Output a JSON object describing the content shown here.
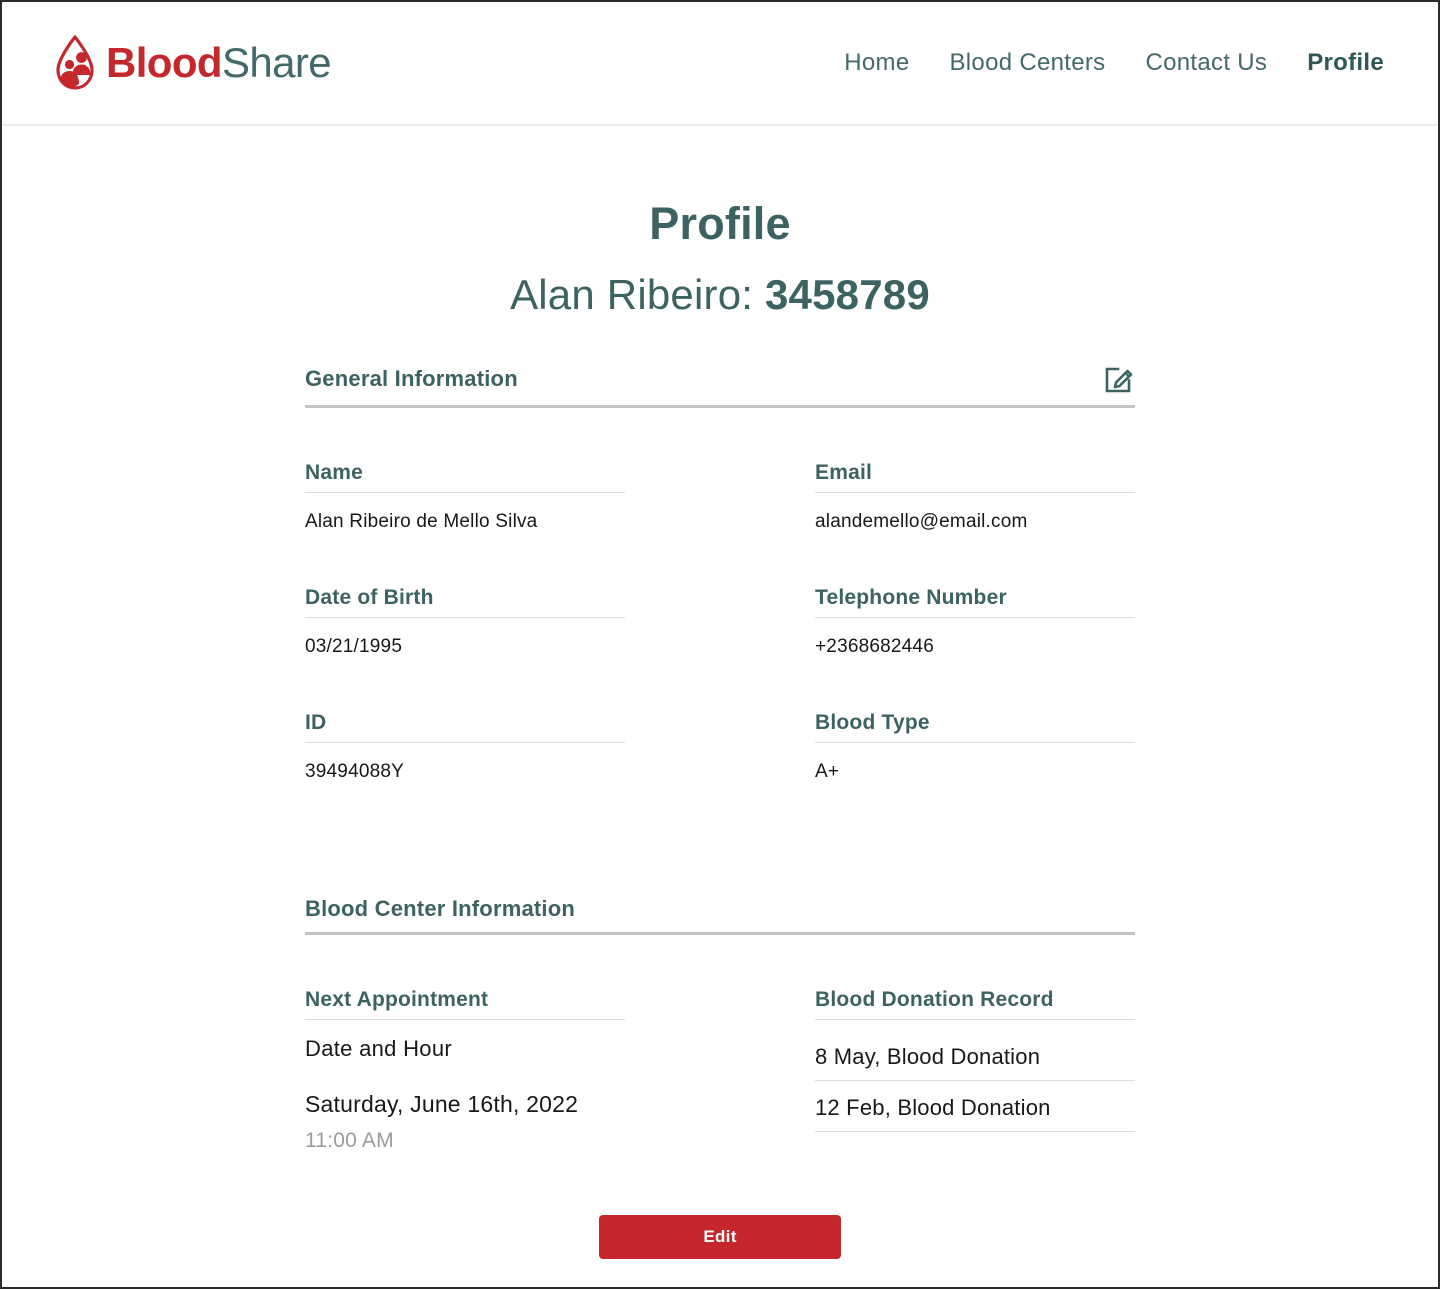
{
  "header": {
    "brand": {
      "icon": "blood-drop-people-icon",
      "part1": "Blood",
      "part2": "Share",
      "color_primary": "#c4282d",
      "color_secondary": "#44696a"
    },
    "nav": [
      {
        "label": "Home",
        "active": false
      },
      {
        "label": "Blood Centers",
        "active": false
      },
      {
        "label": "Contact Us",
        "active": false
      },
      {
        "label": "Profile",
        "active": true
      }
    ]
  },
  "main": {
    "page_title": "Profile",
    "profile_name": "Alan Ribeiro: ",
    "profile_id": "3458789",
    "sections": [
      {
        "title": "General Information",
        "edit_icon": "edit-pencil-icon",
        "fields": [
          {
            "label": "Name",
            "value": "Alan Ribeiro de Mello Silva"
          },
          {
            "label": "Email",
            "value": "alandemello@email.com"
          },
          {
            "label": "Date of Birth",
            "value": "03/21/1995"
          },
          {
            "label": "Telephone Number",
            "value": "+2368682446"
          },
          {
            "label": "ID",
            "value": "39494088Y"
          },
          {
            "label": "Blood Type",
            "value": "A+"
          }
        ]
      },
      {
        "title": "Blood Center Information",
        "appointment": {
          "label": "Next Appointment",
          "heading": "Date and Hour",
          "date": "Saturday, June 16th, 2022",
          "time": "11:00 AM"
        },
        "records": {
          "label": "Blood Donation Record",
          "items": [
            "8 May, Blood Donation",
            "12 Feb, Blood Donation"
          ]
        }
      }
    ]
  },
  "footer": {
    "edit_button": "Edit",
    "edit_button_color": "#c4282d"
  }
}
